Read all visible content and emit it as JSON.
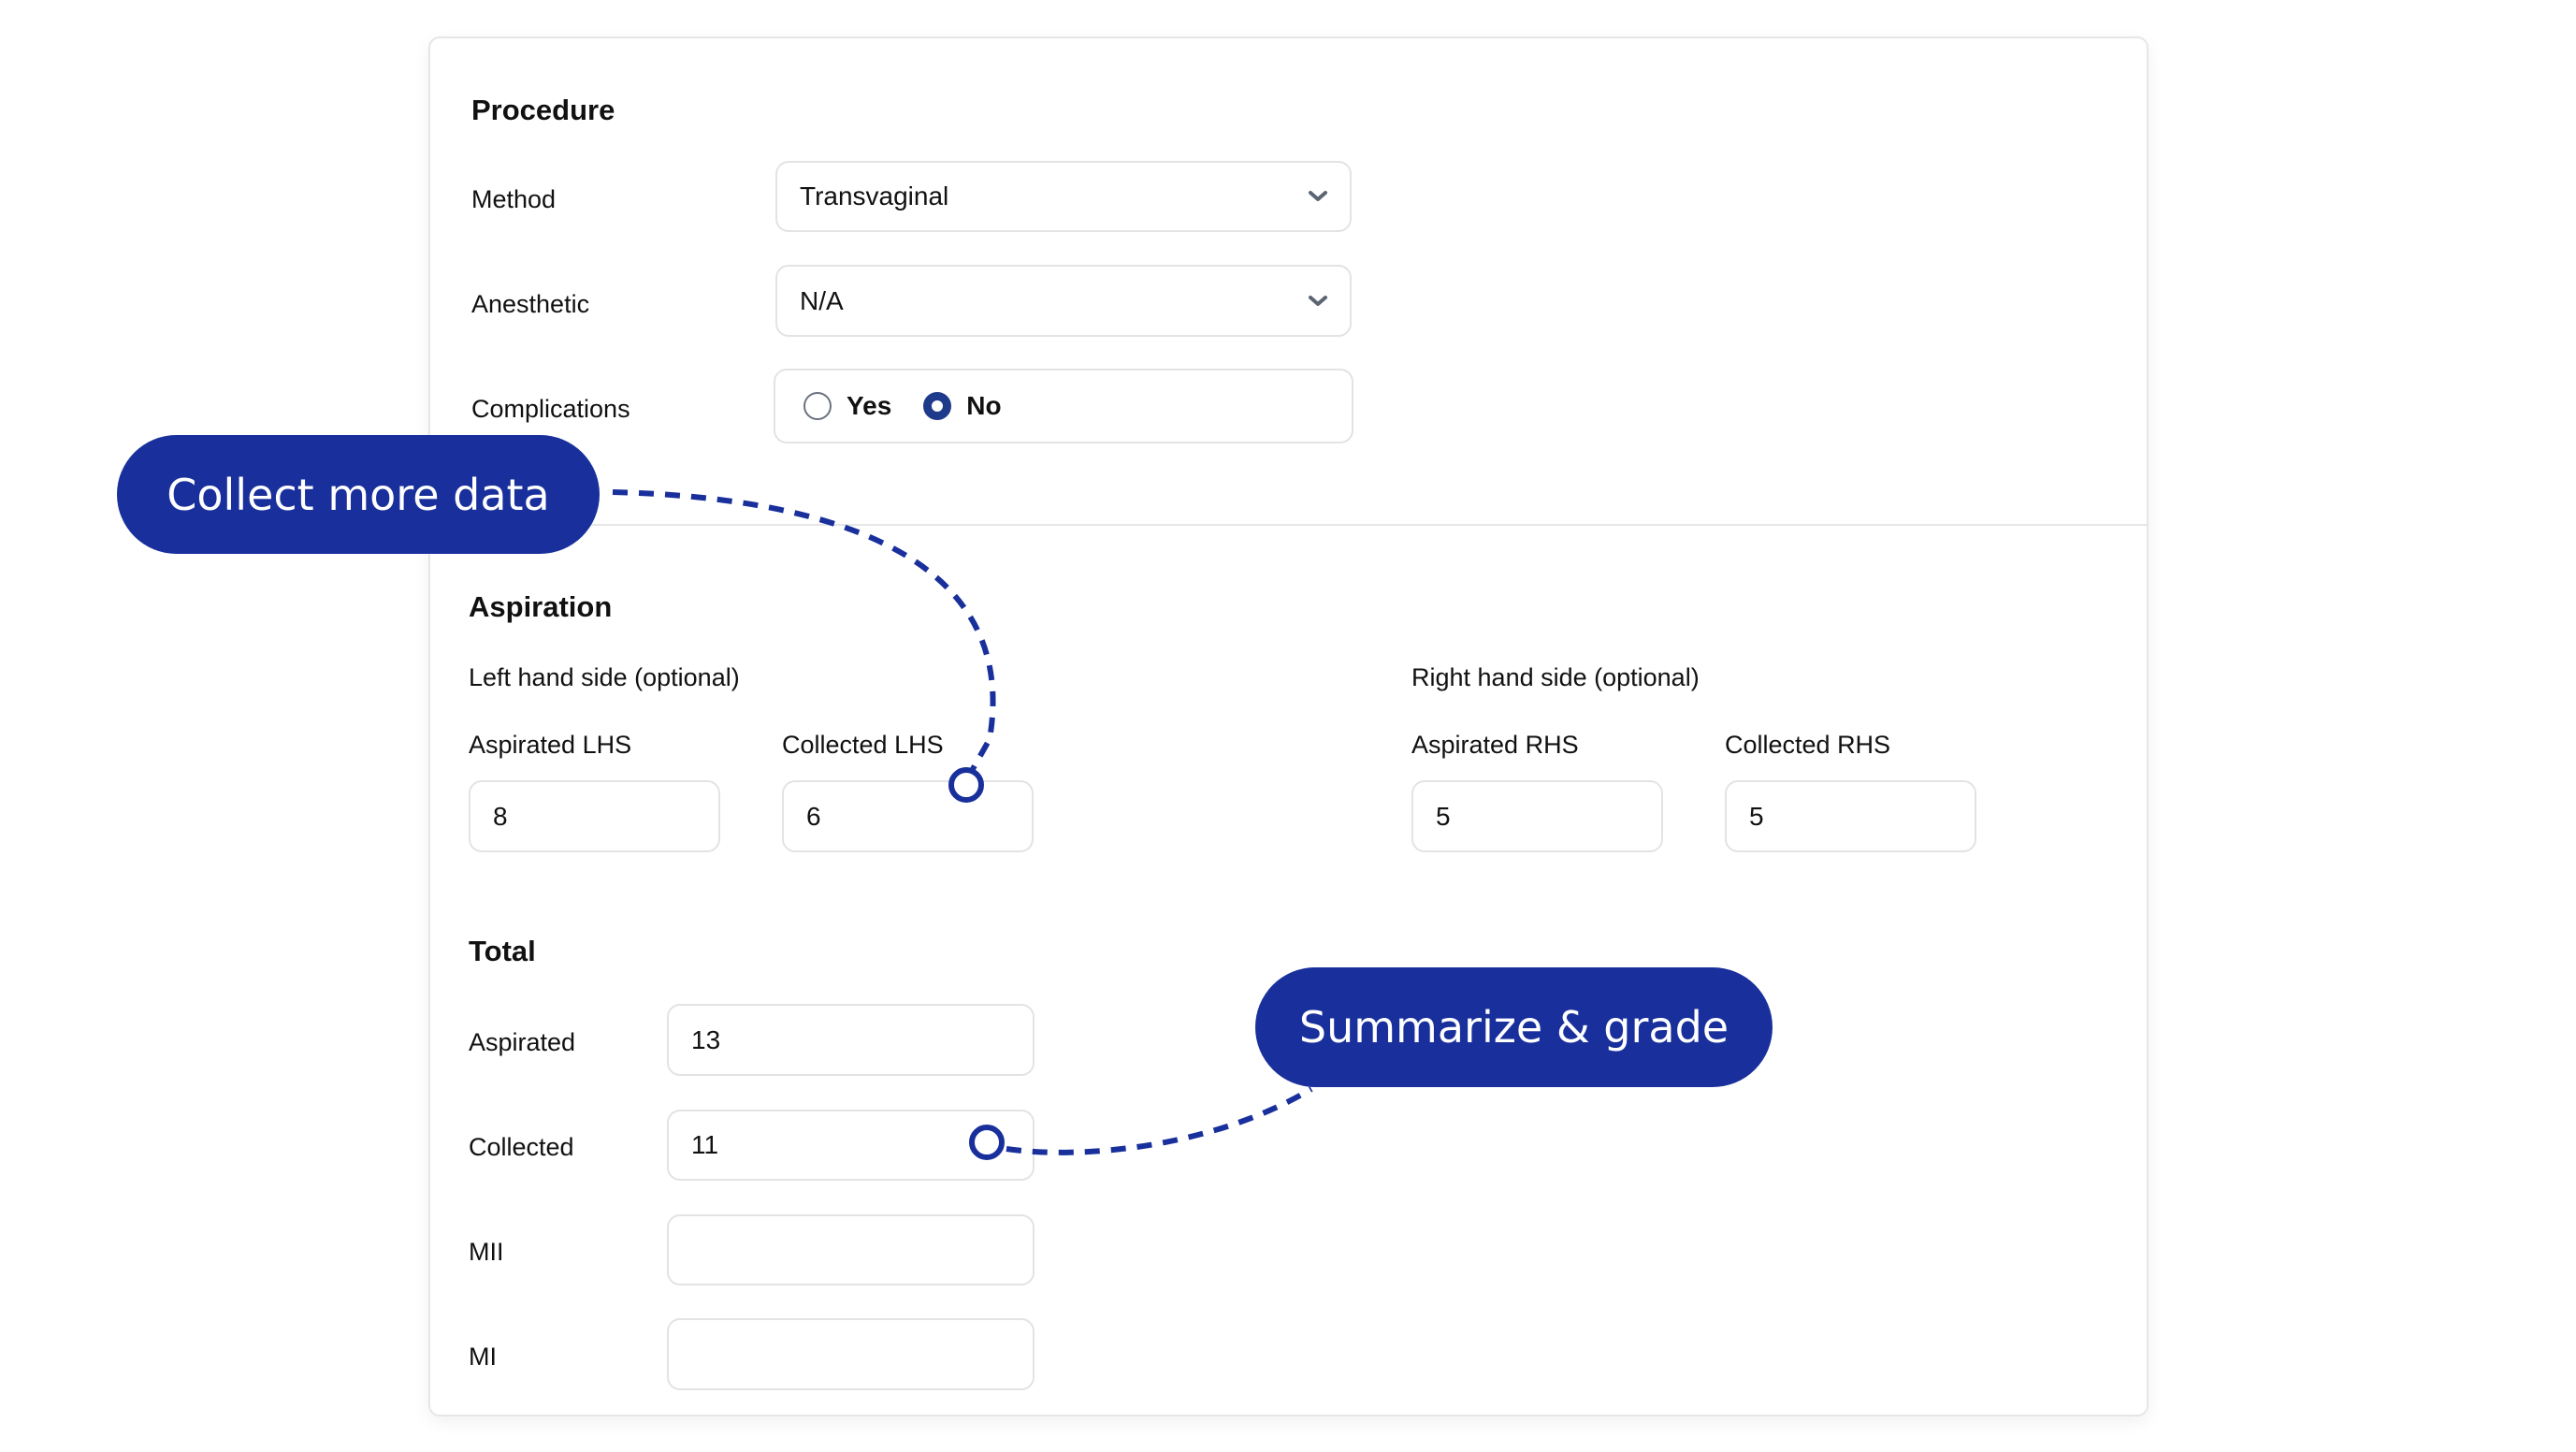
{
  "procedure": {
    "title": "Procedure",
    "method": {
      "label": "Method",
      "value": "Transvaginal",
      "icon": "chevron-down-icon"
    },
    "anesthetic": {
      "label": "Anesthetic",
      "value": "N/A",
      "icon": "chevron-down-icon"
    },
    "complications": {
      "label": "Complications",
      "options": [
        {
          "label": "Yes",
          "selected": false
        },
        {
          "label": "No",
          "selected": true
        }
      ]
    }
  },
  "aspiration": {
    "title": "Aspiration",
    "lhs": {
      "heading": "Left hand side (optional)",
      "aspirated": {
        "label": "Aspirated LHS",
        "value": "8"
      },
      "collected": {
        "label": "Collected LHS",
        "value": "6"
      }
    },
    "rhs": {
      "heading": "Right hand side (optional)",
      "aspirated": {
        "label": "Aspirated RHS",
        "value": "5"
      },
      "collected": {
        "label": "Collected RHS",
        "value": "5"
      }
    }
  },
  "total": {
    "title": "Total",
    "aspirated": {
      "label": "Aspirated",
      "value": "13"
    },
    "collected": {
      "label": "Collected",
      "value": "11"
    },
    "mii": {
      "label": "MII",
      "value": ""
    },
    "mi": {
      "label": "MI",
      "value": ""
    }
  },
  "callouts": {
    "collect_more": "Collect more data",
    "summarize": "Summarize & grade"
  },
  "colors": {
    "accent": "#19309c",
    "radio_selected": "#1e3a8a",
    "border": "#e3e3e3"
  }
}
